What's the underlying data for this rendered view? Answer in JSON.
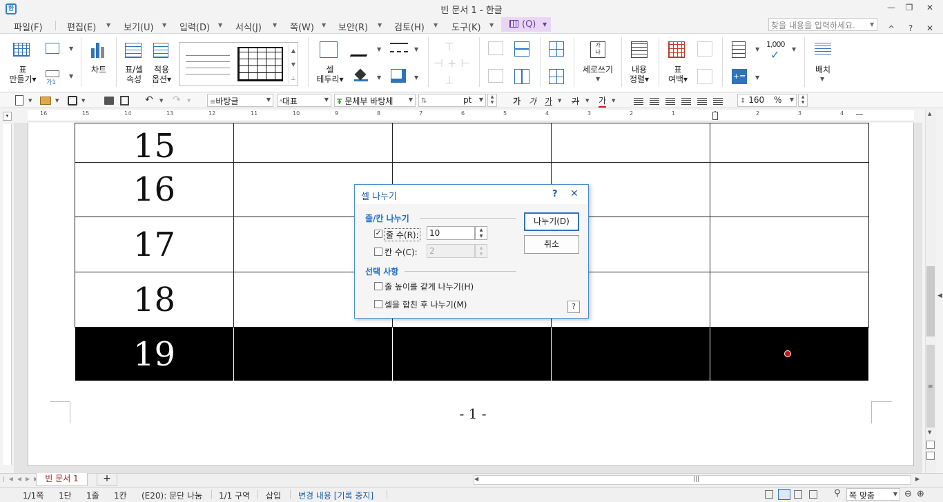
{
  "window": {
    "title": "빈 문서 1 - 한글",
    "app_icon": "한",
    "minimize": "—",
    "restore": "❐",
    "close": "✕",
    "help": "?",
    "collapse": "^"
  },
  "menu": [
    "파일(F)",
    "편집(E)",
    "보기(U)",
    "입력(D)",
    "서식(J)",
    "쪽(W)",
    "보안(R)",
    "검토(H)",
    "도구(K)"
  ],
  "menu_table": "(Q)",
  "find_placeholder": "찾을 내용을 입력하세요.",
  "ribbon": {
    "make_table": "표\n만들기▾",
    "caption": "가1",
    "chart": "차트",
    "table_cell_props": "표/셀\n속성",
    "apply_options": "적용\n옵션▾",
    "cell_border": "셀\n테두리▾",
    "vertical_write": "세로쓰기",
    "content_align": "내용\n정렬▾",
    "table_margin": "표\n여백▾",
    "number_format": "1,000",
    "arrange": "배치"
  },
  "format": {
    "style": "바탕글",
    "representative": "대표",
    "font": "문체부 바탕체",
    "font_prefix": "한",
    "size_unit": "pt",
    "zoom": "160",
    "zoom_unit": "%",
    "bold": "가",
    "italic": "가",
    "underline": "가",
    "strike": "가",
    "color": "가"
  },
  "ruler": [
    "16",
    "15",
    "14",
    "13",
    "12",
    "11",
    "10",
    "9",
    "8",
    "7",
    "6",
    "5",
    "4",
    "3",
    "2",
    "1",
    "1",
    "2",
    "3",
    "4"
  ],
  "table_rows": [
    {
      "num": "15",
      "selected": false
    },
    {
      "num": "16",
      "selected": false
    },
    {
      "num": "17",
      "selected": false
    },
    {
      "num": "18",
      "selected": false
    },
    {
      "num": "19",
      "selected": true
    }
  ],
  "page_number": "- 1 -",
  "dialog": {
    "title": "셀 나누기",
    "help": "?",
    "close": "✕",
    "group1": "줄/칸 나누기",
    "rows_label": "줄 수(R):",
    "rows_value": "10",
    "rows_checked": "✓",
    "cols_label": "칸 수(C):",
    "cols_value": "2",
    "group2": "선택 사항",
    "opt1": "줄 높이를 같게 나누기(H)",
    "opt2": "셀을 합친 후 나누기(M)",
    "btn_split": "나누기(D)",
    "btn_cancel": "취소",
    "help_box": "?"
  },
  "tabs": {
    "doc": "빈 문서 1",
    "add": "+"
  },
  "status": [
    "1/1쪽",
    "1단",
    "1줄",
    "1칸",
    "(E20): 문단 나눔",
    "1/1 구역",
    "삽입"
  ],
  "status_track": "변경 내용 [기록 중지]",
  "status_zoom": "쪽 맞춤",
  "colors": {
    "accent": "#1d6fc4",
    "table_tab": "#e9d6f4",
    "track_text": "#1d5fa8"
  }
}
